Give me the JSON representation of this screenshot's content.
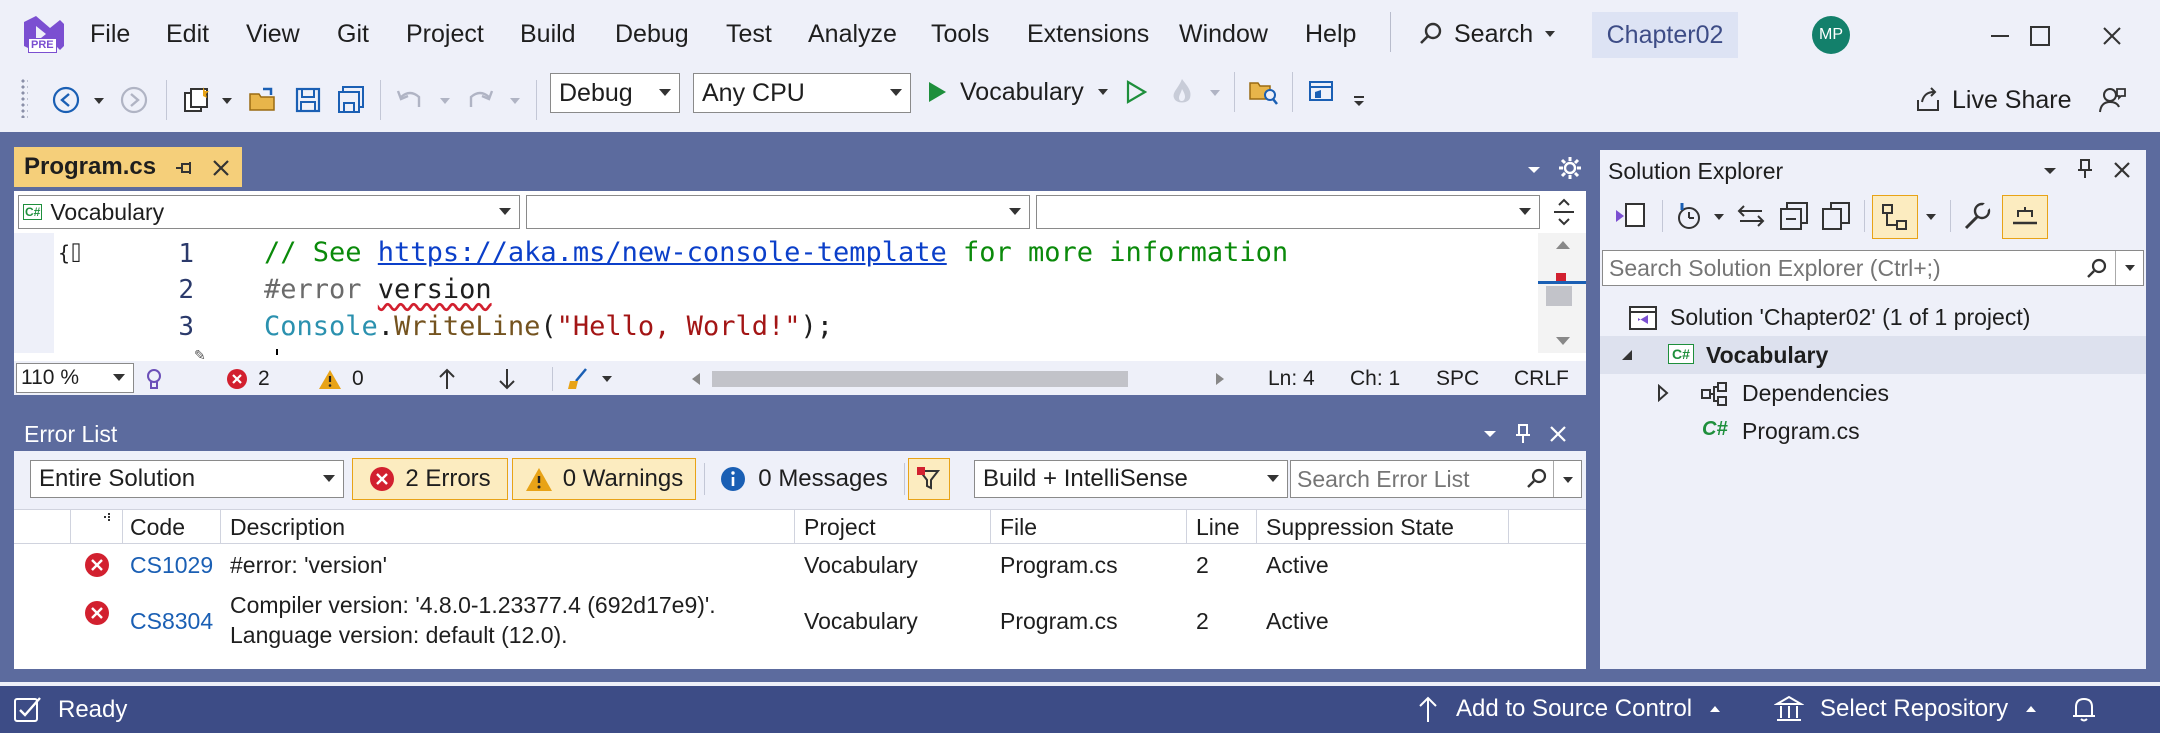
{
  "menu": {
    "items": [
      "File",
      "Edit",
      "View",
      "Git",
      "Project",
      "Build",
      "Debug",
      "Test",
      "Analyze",
      "Tools",
      "Extensions",
      "Window",
      "Help"
    ],
    "search_label": "Search",
    "solution_name": "Chapter02",
    "avatar_initials": "MP",
    "logo_badge": "PRE"
  },
  "toolbar": {
    "configuration": "Debug",
    "platform": "Any CPU",
    "run_target": "Vocabulary",
    "live_share": "Live Share"
  },
  "editor": {
    "tab_label": "Program.cs",
    "nav_project": "Vocabulary",
    "nav_project_badge": "C#",
    "line_numbers": [
      "1",
      "2",
      "3"
    ],
    "line1_comment_prefix": "// See ",
    "line1_link": "https://aka.ms/new-console-template",
    "line1_comment_suffix": " for more information",
    "line2_directive": "#error ",
    "line2_word": "version",
    "line3_class": "Console",
    "line3_dot": ".",
    "line3_method": "WriteLine",
    "line3_open": "(",
    "line3_string": "\"Hello, World!\"",
    "line3_close": ");",
    "zoom": "110 %",
    "error_count": "2",
    "warning_count": "0",
    "ln": "Ln: 4",
    "ch": "Ch: 1",
    "spc": "SPC",
    "crlf": "CRLF"
  },
  "error_list": {
    "title": "Error List",
    "scope": "Entire Solution",
    "errors_btn": "2 Errors",
    "warnings_btn": "0 Warnings",
    "messages_btn": "0 Messages",
    "source": "Build + IntelliSense",
    "search_placeholder": "Search Error List",
    "columns": [
      "Code",
      "Description",
      "Project",
      "File",
      "Line",
      "Suppression State"
    ],
    "rows": [
      {
        "code": "CS1029",
        "desc1": "#error: 'version'",
        "desc2": "",
        "project": "Vocabulary",
        "file": "Program.cs",
        "line": "2",
        "state": "Active"
      },
      {
        "code": "CS8304",
        "desc1": "Compiler version: '4.8.0-1.23377.4 (692d17e9)'.",
        "desc2": "Language version: default (12.0).",
        "project": "Vocabulary",
        "file": "Program.cs",
        "line": "2",
        "state": "Active"
      }
    ]
  },
  "solution_explorer": {
    "title": "Solution Explorer",
    "search_placeholder": "Search Solution Explorer (Ctrl+;)",
    "solution_item": "Solution 'Chapter02' (1 of 1 project)",
    "project_item": "Vocabulary",
    "project_badge": "C#",
    "dependencies_item": "Dependencies",
    "file_item": "Program.cs",
    "file_badge": "C#"
  },
  "status": {
    "ready": "Ready",
    "add_source_control": "Add to Source Control",
    "select_repository": "Select Repository"
  },
  "colors": {
    "accent_blue": "#3d4c86",
    "frame": "#5c6b9e",
    "active_tab": "#f5cf7a",
    "error_red": "#d2202f",
    "warning_yellow": "#e8a317",
    "run_green": "#1e8f3c",
    "link_blue": "#0b3fc9",
    "comment_green": "#0a8a0a"
  }
}
